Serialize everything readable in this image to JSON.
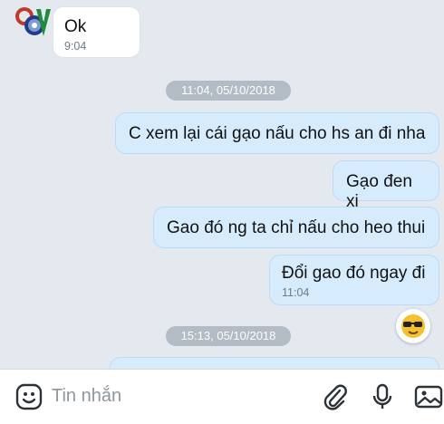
{
  "conversation": {
    "incoming": {
      "text": "Ok",
      "time": "9:04"
    },
    "date_separators": [
      "11:04, 05/10/2018",
      "15:13, 05/10/2018"
    ],
    "outgoing": [
      {
        "text": "C xem lại cái gạo nấu cho hs an đi nha"
      },
      {
        "text": "Gạo đen xi"
      },
      {
        "text": "Gao đó ng ta chỉ nấu cho heo thui"
      },
      {
        "text": "Đổi gao đó ngay đi",
        "time": "11:04"
      }
    ]
  },
  "composer": {
    "placeholder": "Tin nhắn",
    "icons": [
      "sticker-face-icon",
      "paperclip-icon",
      "microphone-icon",
      "image-icon"
    ]
  },
  "colors": {
    "background": "#e4e9ef",
    "outgoing_bubble": "#d6ecfd",
    "incoming_bubble": "#ffffff",
    "separator": "#b3bbc4"
  }
}
